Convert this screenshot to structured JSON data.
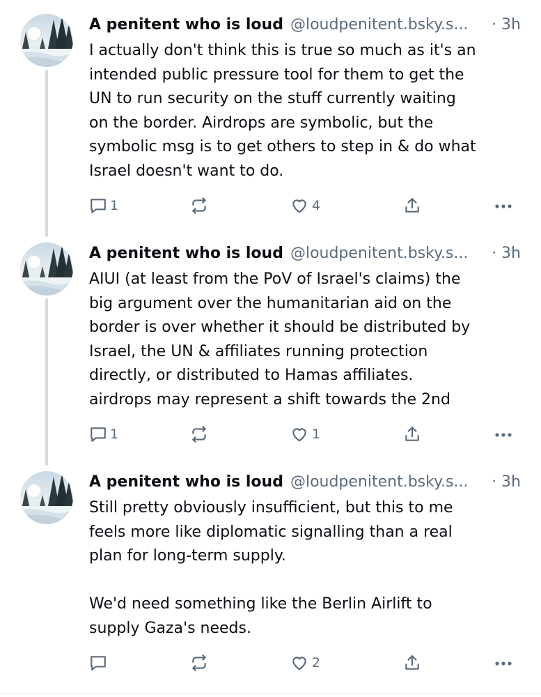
{
  "posts": [
    {
      "author": "A penitent who is loud",
      "handle": "@loudpenitent.bsky.s...",
      "time": "· 3h",
      "text": "I actually don't think this is true so much as it's an\nintended public pressure tool for them to get the\nUN to run security on the stuff currently waiting\non the border. Airdrops are symbolic, but the\nsymbolic msg is to get others to step in & do what\nIsrael doesn't want to do.",
      "replies": "1",
      "reposts": "",
      "likes": "4"
    },
    {
      "author": "A penitent who is loud",
      "handle": "@loudpenitent.bsky.s...",
      "time": "· 3h",
      "text": "AIUI (at least from the PoV of Israel's claims) the\nbig argument over the humanitarian aid on the\nborder is over whether it should be distributed by\nIsrael, the UN & affiliates running protection\ndirectly, or distributed to Hamas affiliates.\nairdrops may represent a shift towards the 2nd",
      "replies": "1",
      "reposts": "",
      "likes": "1"
    },
    {
      "author": "A penitent who is loud",
      "handle": "@loudpenitent.bsky.s...",
      "time": "· 3h",
      "text": "Still pretty obviously insufficient, but this to me\nfeels more like diplomatic signalling than a real\nplan for long-term supply.\n\nWe'd need something like the Berlin Airlift to\nsupply Gaza's needs.",
      "replies": "",
      "reposts": "",
      "likes": "2"
    }
  ],
  "icons": {
    "reply": "reply-icon",
    "repost": "repost-icon",
    "like": "heart-icon",
    "share": "share-icon",
    "more": "more-icon"
  },
  "colors": {
    "text": "#0b0f14",
    "muted": "#5b6b7b",
    "thread_line": "#d4dbe2"
  }
}
